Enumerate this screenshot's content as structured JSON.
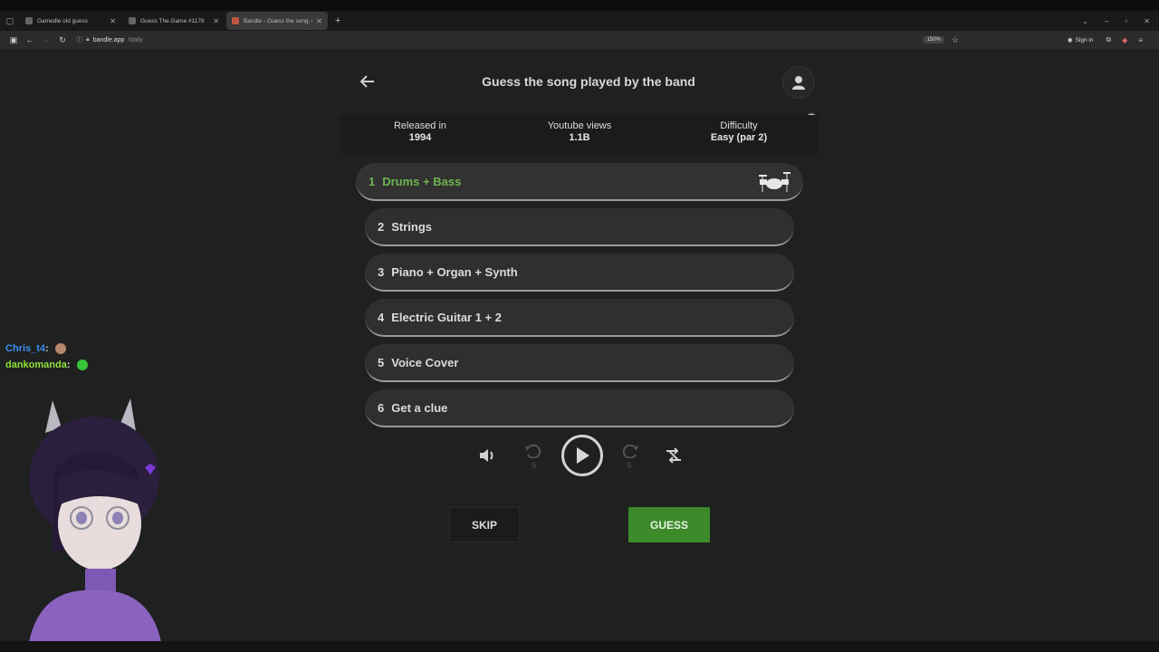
{
  "browser": {
    "tabs": [
      {
        "title": "Gamedle old guess",
        "active": false
      },
      {
        "title": "Guess The.Game #1176",
        "active": false
      },
      {
        "title": "Bandle - Guess the song, one in",
        "active": true
      }
    ],
    "url_host": "bandle.app",
    "url_path": "/daily",
    "zoom": "150%",
    "signin_label": "Sign in"
  },
  "header": {
    "title": "Guess the song played by the band"
  },
  "stats": [
    {
      "label": "Released in",
      "value": "1994"
    },
    {
      "label": "Youtube views",
      "value": "1.1B"
    },
    {
      "label": "Difficulty",
      "value": "Easy (par 2)"
    }
  ],
  "tracks": [
    {
      "num": "1",
      "label": "Drums + Bass",
      "active": true
    },
    {
      "num": "2",
      "label": "Strings"
    },
    {
      "num": "3",
      "label": "Piano + Organ + Synth"
    },
    {
      "num": "4",
      "label": "Electric Guitar 1 + 2"
    },
    {
      "num": "5",
      "label": "Voice Cover"
    },
    {
      "num": "6",
      "label": "Get a clue"
    }
  ],
  "controls": {
    "rewind_seconds": "5",
    "forward_seconds": "5"
  },
  "buttons": {
    "skip": "SKIP",
    "guess": "GUESS"
  },
  "chat": [
    {
      "user": "Chris_t4",
      "sep": ":"
    },
    {
      "user": "dankomanda",
      "sep": ":"
    }
  ],
  "colors": {
    "accent_green": "#3c8a2a",
    "active_track_text": "#6fb64e"
  }
}
